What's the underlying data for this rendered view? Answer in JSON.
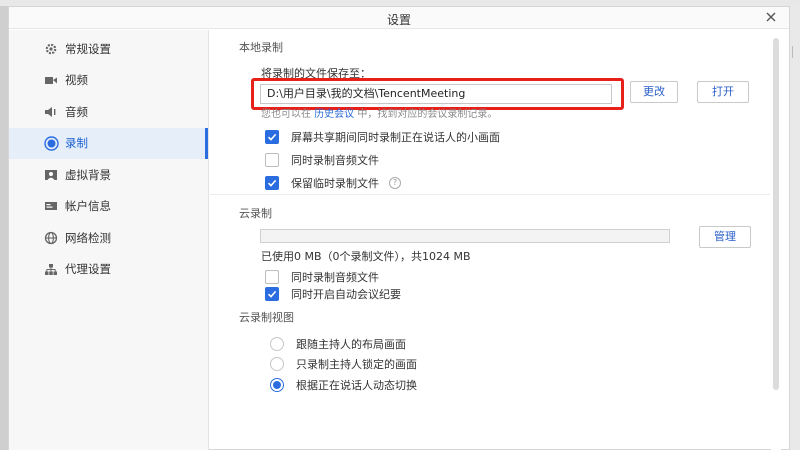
{
  "window": {
    "title": "设置"
  },
  "sidebar": {
    "items": [
      {
        "label": "常规设置",
        "icon": "gear-icon"
      },
      {
        "label": "视频",
        "icon": "video-camera-icon"
      },
      {
        "label": "音频",
        "icon": "speaker-icon"
      },
      {
        "label": "录制",
        "icon": "record-icon",
        "active": true
      },
      {
        "label": "虚拟背景",
        "icon": "virtual-background-icon"
      },
      {
        "label": "帐户信息",
        "icon": "account-card-icon"
      },
      {
        "label": "网络检测",
        "icon": "globe-icon"
      },
      {
        "label": "代理设置",
        "icon": "proxy-network-icon"
      }
    ]
  },
  "local": {
    "section_title": "本地录制",
    "save_label": "将录制的文件保存至：",
    "path_value": "D:\\用户目录\\我的文档\\TencentMeeting",
    "change_button": "更改",
    "open_button": "打开",
    "hint_prefix": "您也可以在",
    "hint_link": "历史会议",
    "hint_suffix": "中，找到对应的会议录制记录。",
    "options": [
      {
        "label": "屏幕共享期间同时录制正在说话人的小画面",
        "checked": true
      },
      {
        "label": "同时录制音频文件",
        "checked": false
      },
      {
        "label": "保留临时录制文件",
        "checked": true
      }
    ],
    "help_icon_glyph": "?"
  },
  "cloud": {
    "section_title": "云录制",
    "manage_button": "管理",
    "usage_fraction": 0,
    "usage_text": "已使用0 MB（0个录制文件），共1024 MB",
    "options": [
      {
        "label": "同时录制音频文件",
        "checked": false
      },
      {
        "label": "同时开启自动会议纪要",
        "checked": true
      }
    ]
  },
  "cloud_view": {
    "section_title": "云录制视图",
    "options": [
      {
        "label": "跟随主持人的布局画面",
        "selected": false
      },
      {
        "label": "只录制主持人锁定的画面",
        "selected": false
      },
      {
        "label": "根据正在说话人动态切换",
        "selected": true
      }
    ]
  },
  "colors": {
    "accent": "#2b6de0",
    "highlight": "#e8201a"
  }
}
